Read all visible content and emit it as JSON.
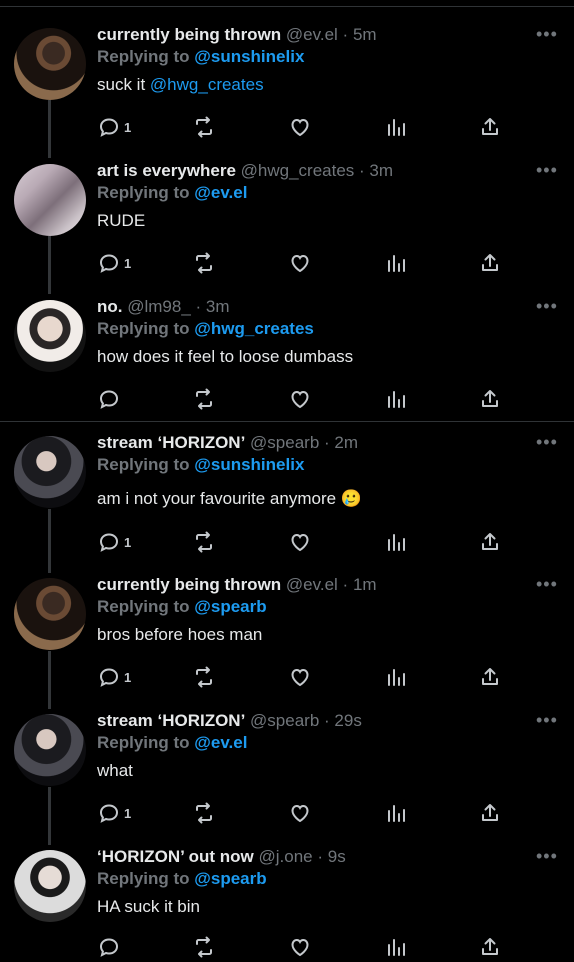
{
  "tweets": [
    {
      "name": "currently being thrown",
      "handle": "@ev.el",
      "time": "5m",
      "replying_label": "Replying to",
      "replying_to": "@sunshinelix",
      "text": "suck it",
      "mention": "@hwg_creates",
      "reply_count": "1",
      "more": "•••"
    },
    {
      "name": "art is everywhere",
      "handle": "@hwg_creates",
      "time": "3m",
      "replying_label": "Replying to",
      "replying_to": "@ev.el",
      "text": "RUDE",
      "mention": "",
      "reply_count": "1",
      "more": "•••"
    },
    {
      "name": "no.",
      "handle": "@lm98_",
      "time": "3m",
      "replying_label": "Replying to",
      "replying_to": "@hwg_creates",
      "text": "how does it feel to loose dumbass",
      "mention": "",
      "reply_count": "",
      "more": "•••"
    },
    {
      "name": "stream ‘HORIZON’",
      "handle": "@spearb",
      "time": "2m",
      "replying_label": "Replying to",
      "replying_to": "@sunshinelix",
      "text": "am i not your favourite anymore 🥲",
      "mention": "",
      "reply_count": "1",
      "more": "•••"
    },
    {
      "name": "currently being thrown",
      "handle": "@ev.el",
      "time": "1m",
      "replying_label": "Replying to",
      "replying_to": "@spearb",
      "text": "bros before hoes man",
      "mention": "",
      "reply_count": "1",
      "more": "•••"
    },
    {
      "name": "stream ‘HORIZON’",
      "handle": "@spearb",
      "time": "29s",
      "replying_label": "Replying to",
      "replying_to": "@ev.el",
      "text": "what",
      "mention": "",
      "reply_count": "1",
      "more": "•••"
    },
    {
      "name": "‘HORIZON’ out now",
      "handle": "@j.one",
      "time": "9s",
      "replying_label": "Replying to",
      "replying_to": "@spearb",
      "text": "HA suck it bin",
      "mention": "",
      "reply_count": "",
      "more": "•••"
    }
  ],
  "sep": " · ",
  "icons": {
    "reply": "reply-icon",
    "retweet": "retweet-icon",
    "like": "like-icon",
    "views": "views-icon",
    "share": "share-icon"
  },
  "colors": {
    "background": "#000000",
    "accent": "#1d9bf0",
    "muted": "#71767b",
    "text": "#e7e9ea"
  }
}
